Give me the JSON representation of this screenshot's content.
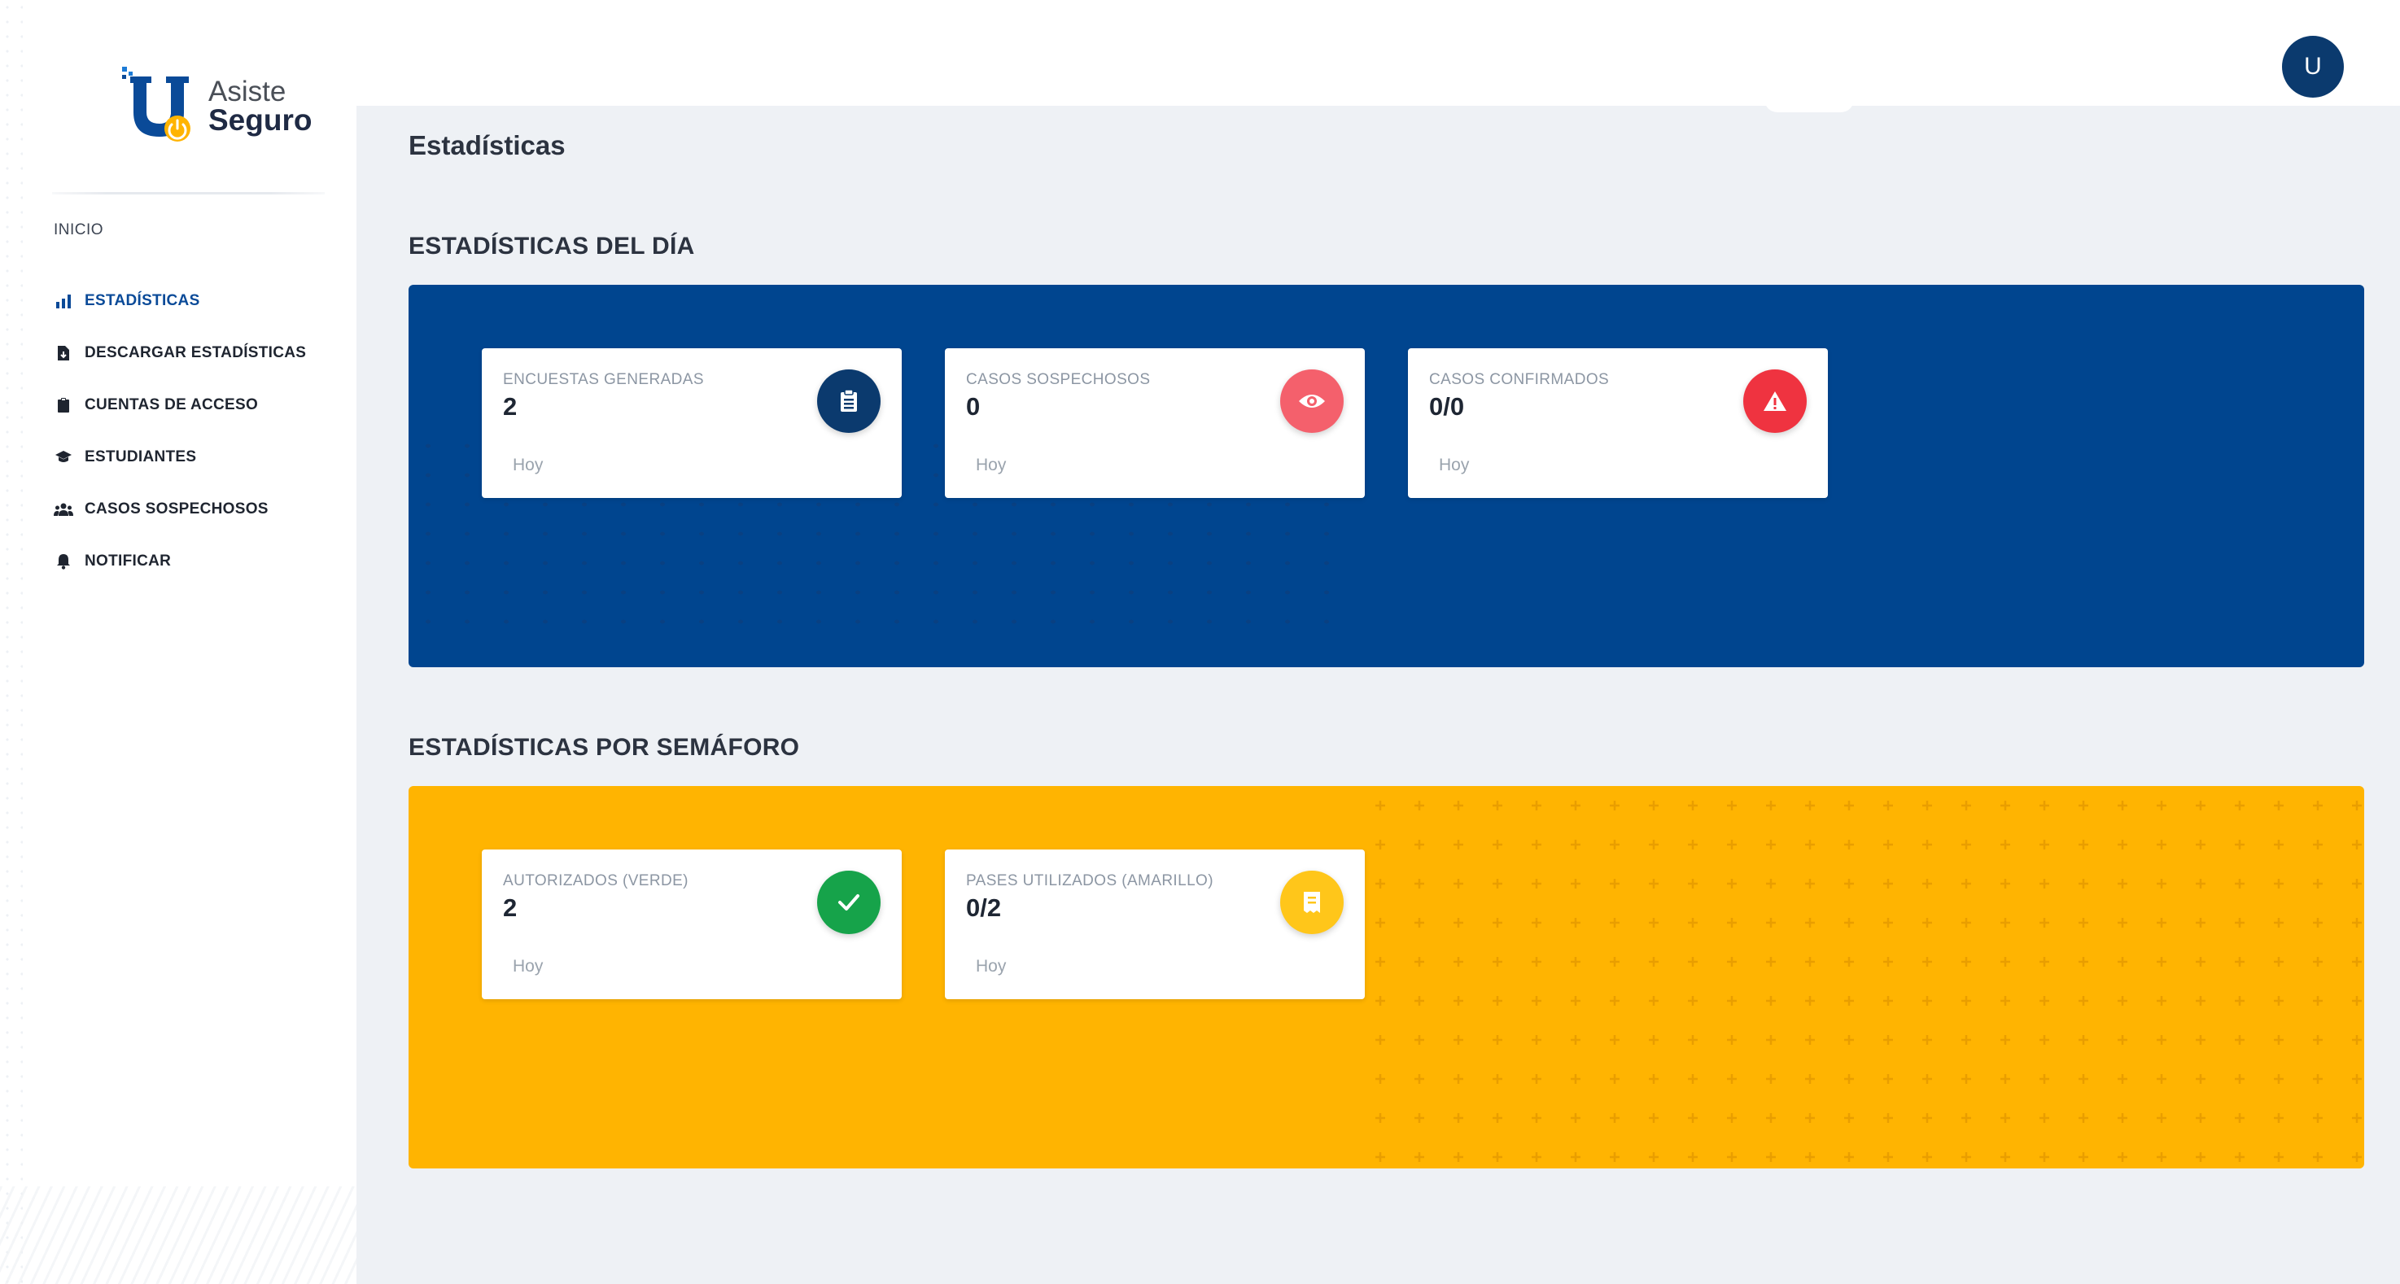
{
  "brand": {
    "line1": "Asiste",
    "line2": "Seguro"
  },
  "sidebar": {
    "section": "INICIO",
    "items": [
      {
        "label": "ESTADÍSTICAS",
        "icon": "bar-chart-icon",
        "active": true
      },
      {
        "label": "DESCARGAR ESTADÍSTICAS",
        "icon": "file-download-icon",
        "active": false
      },
      {
        "label": "CUENTAS DE ACCESO",
        "icon": "clipboard-icon",
        "active": false
      },
      {
        "label": "ESTUDIANTES",
        "icon": "graduation-cap-icon",
        "active": false
      },
      {
        "label": "CASOS SOSPECHOSOS",
        "icon": "users-icon",
        "active": false
      },
      {
        "label": "NOTIFICAR",
        "icon": "bell-icon",
        "active": false
      }
    ]
  },
  "header": {
    "avatar_initial": "U"
  },
  "page": {
    "title": "Estadísticas"
  },
  "daily": {
    "title": "ESTADÍSTICAS DEL DÍA",
    "color": "#00458f",
    "cards": [
      {
        "label": "ENCUESTAS GENERADAS",
        "value": "2",
        "foot": "Hoy",
        "icon": "clipboard-list-icon",
        "icon_color": "#0b3a6e"
      },
      {
        "label": "CASOS SOSPECHOSOS",
        "value": "0",
        "foot": "Hoy",
        "icon": "eye-icon",
        "icon_color": "#f4606c"
      },
      {
        "label": "CASOS CONFIRMADOS",
        "value": "0/0",
        "foot": "Hoy",
        "icon": "warning-icon",
        "icon_color": "#ef3340"
      }
    ]
  },
  "semaforo": {
    "title": "ESTADÍSTICAS POR SEMÁFORO",
    "color": "#ffb401",
    "cards": [
      {
        "label": "AUTORIZADOS (VERDE)",
        "value": "2",
        "foot": "Hoy",
        "icon": "check-icon",
        "icon_color": "#16a34a"
      },
      {
        "label": "PASES UTILIZADOS (AMARILLO)",
        "value": "0/2",
        "foot": "Hoy",
        "icon": "ticket-icon",
        "icon_color": "#ffc61a"
      }
    ]
  }
}
